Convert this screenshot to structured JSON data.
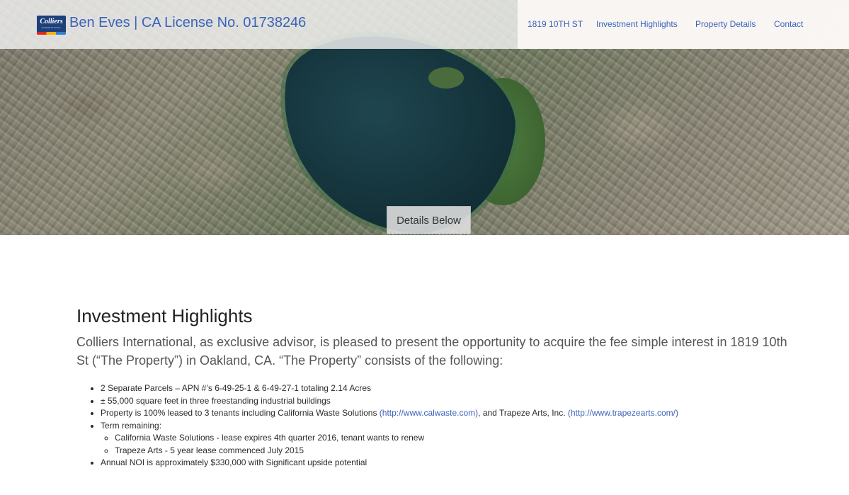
{
  "header": {
    "title": "Ben Eves | CA License No. 01738246",
    "logo": {
      "text": "Colliers",
      "subtext": "INTERNATIONAL",
      "brand_color": "#1d3f7a"
    },
    "nav": [
      {
        "label": "1819 10TH ST"
      },
      {
        "label": "Investment Highlights"
      },
      {
        "label": "Property Details"
      },
      {
        "label": "Contact"
      }
    ]
  },
  "hero": {
    "button_label": "Details Below"
  },
  "main": {
    "section_title": "Investment Highlights",
    "intro": "Colliers International, as exclusive advisor, is pleased to present the opportunity to acquire the fee simple interest in 1819 10th St (“The Property”) in Oakland, CA. “The Property” consists of the following:",
    "bullets": {
      "parcels": "2 Separate Parcels – APN #’s 6-49-25-1 & 6-49-27-1 totaling 2.14 Acres",
      "sqft": "± 55,000 square feet in three freestanding industrial buildings",
      "leased_prefix": "Property is 100% leased to 3 tenants including California Waste Solutions ",
      "leased_link1": "(http://www.calwaste.com)",
      "leased_mid": ", and Trapeze Arts, Inc. ",
      "leased_link2": "(http://www.trapezearts.com/)",
      "term": "Term remaining:",
      "term_sub": [
        "California Waste Solutions - lease expires 4th quarter 2016, tenant wants to renew",
        "Trapeze Arts - 5 year lease commenced July 2015"
      ],
      "noi": "Annual NOI is approximately $330,000 with Significant upside potential"
    }
  },
  "colors": {
    "link": "#3a63ba",
    "lake": "#14323a"
  }
}
